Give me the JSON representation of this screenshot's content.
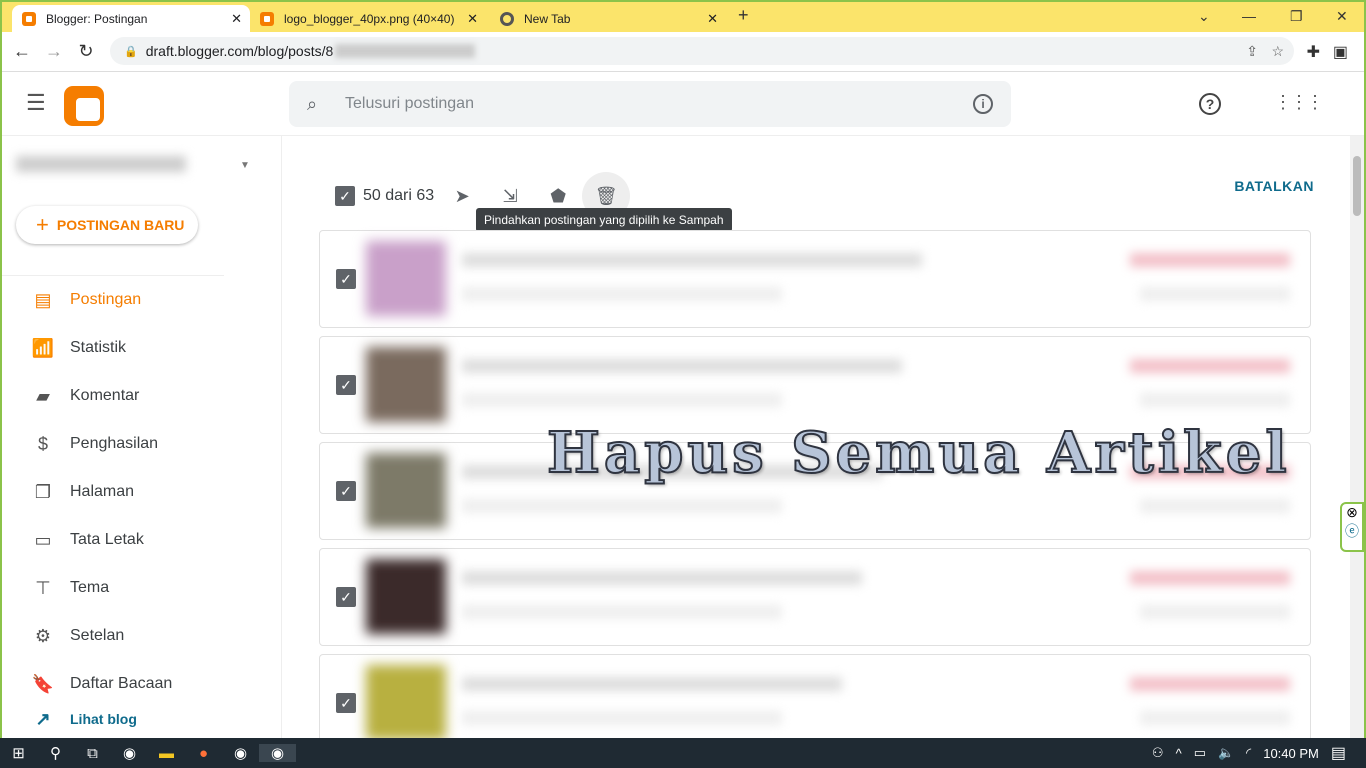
{
  "browser": {
    "tabs": [
      {
        "title": "Blogger: Postingan",
        "active": true
      },
      {
        "title": "logo_blogger_40px.png (40×40)",
        "active": false
      },
      {
        "title": "New Tab",
        "active": false
      }
    ],
    "url": "draft.blogger.com/blog/posts/8"
  },
  "header": {
    "search_placeholder": "Telusuri postingan"
  },
  "sidebar": {
    "new_post": "POSTINGAN BARU",
    "items": [
      {
        "label": "Postingan",
        "icon": "posts-icon",
        "active": true
      },
      {
        "label": "Statistik",
        "icon": "stats-icon"
      },
      {
        "label": "Komentar",
        "icon": "comment-icon"
      },
      {
        "label": "Penghasilan",
        "icon": "dollar-icon"
      },
      {
        "label": "Halaman",
        "icon": "pages-icon"
      },
      {
        "label": "Tata Letak",
        "icon": "layout-icon"
      },
      {
        "label": "Tema",
        "icon": "paint-roller-icon"
      },
      {
        "label": "Setelan",
        "icon": "gear-icon"
      },
      {
        "label": "Daftar Bacaan",
        "icon": "bookmark-icon"
      },
      {
        "label": "Lihat blog",
        "icon": "external-link-icon"
      }
    ]
  },
  "toolbar": {
    "selection_count": "50 dari 63",
    "tooltip": "Pindahkan postingan yang dipilih ke Sampah",
    "cancel": "BATALKAN"
  },
  "overlay_title": "Hapus Semua Artikel",
  "taskbar": {
    "time": "10:40 PM"
  },
  "colors": {
    "accent": "#f57d00",
    "frame": "#8bc34a",
    "tabbar": "#fbe46b"
  }
}
